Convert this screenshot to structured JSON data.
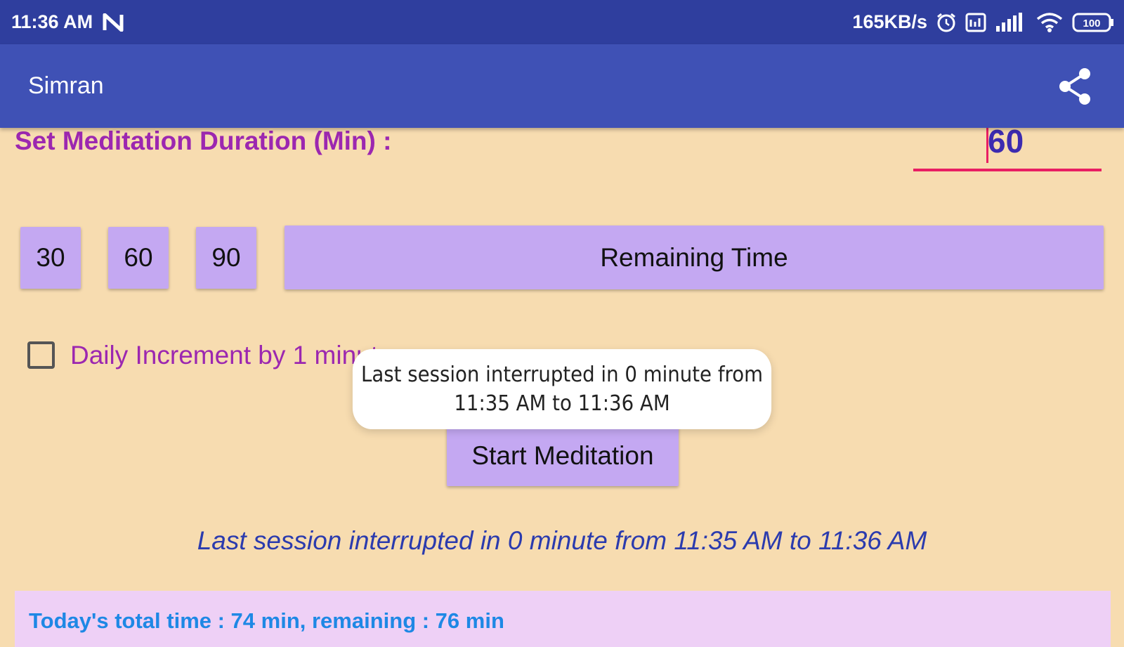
{
  "status_bar": {
    "time": "11:36 AM",
    "net_speed": "165KB/s",
    "battery": "100",
    "icons": [
      "nfc-icon",
      "alarm-icon",
      "sim-icon",
      "signal-icon",
      "wifi-icon",
      "battery-icon"
    ]
  },
  "app_bar": {
    "title": "Simran",
    "share_icon": "share-icon"
  },
  "duration": {
    "label": "Set Meditation Duration (Min) :",
    "value": "60"
  },
  "presets": [
    "30",
    "60",
    "90"
  ],
  "remaining_button": "Remaining Time",
  "daily_increment": {
    "label": "Daily Increment by 1 minute",
    "checked": false
  },
  "start_button": "Start Meditation",
  "toast": {
    "line1": "Last session interrupted in 0 minute from",
    "line2": "11:35 AM to 11:36 AM"
  },
  "last_session_text": "Last session interrupted in 0 minute from 11:35 AM to 11:36 AM",
  "summary": {
    "text": "Today's total time : 74 min, remaining : 76 min"
  },
  "colors": {
    "status_bar": "#2F3E9E",
    "app_bar": "#3F51B5",
    "background": "#F7DCB0",
    "button": "#C4A8F2",
    "accent_purple": "#9C27B0",
    "underline_pink": "#E91E63",
    "summary_panel": "#EED0F6",
    "summary_text": "#1E88E5"
  }
}
